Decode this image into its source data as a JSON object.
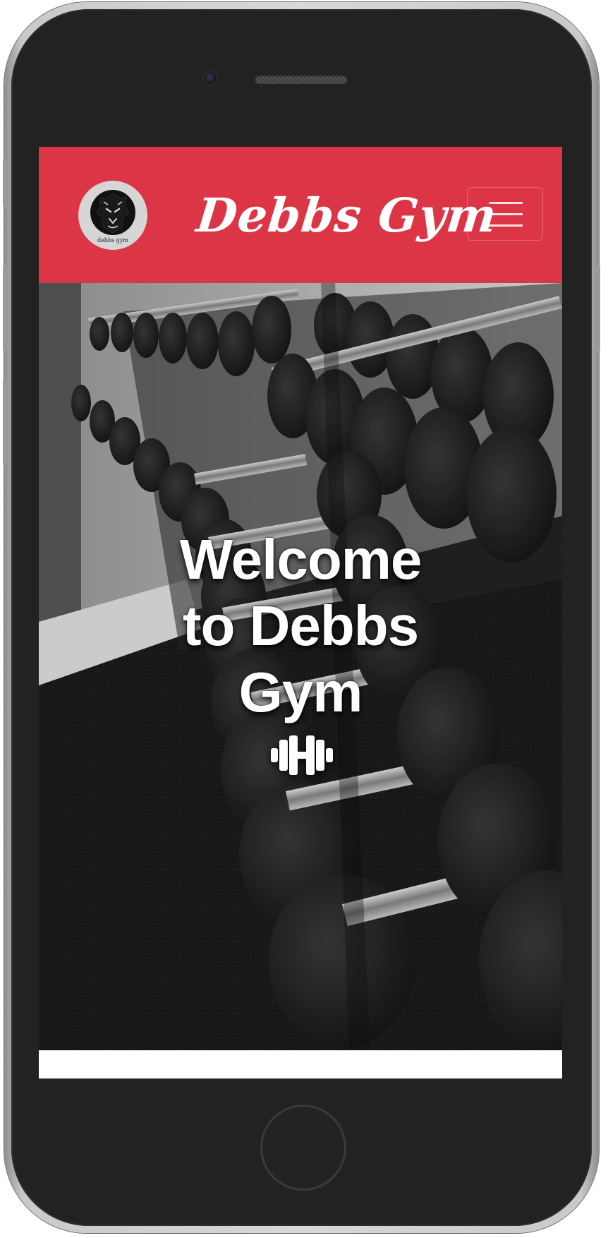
{
  "navbar": {
    "brand": "Debbs Gym",
    "logo_caption": "debbs gym",
    "logo_icon": "lion-head-icon",
    "toggler_icon": "hamburger-menu-icon",
    "background_color": "#dc3545"
  },
  "hero": {
    "title": "Welcome to Debbs Gym",
    "icon": "dumbbell-icon",
    "background_image": "black-and-white dumbbell rack photo"
  },
  "colors": {
    "brand_red": "#dc3545",
    "text_white": "#ffffff"
  }
}
